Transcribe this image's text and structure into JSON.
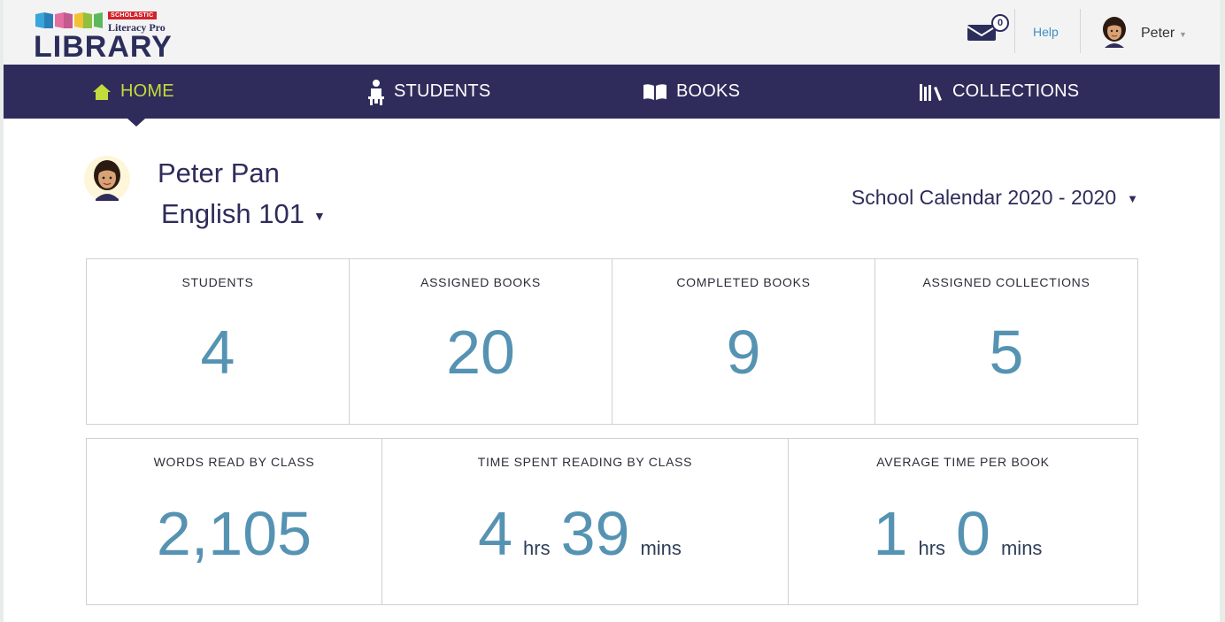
{
  "brand": {
    "badge": "SCHOLASTIC",
    "subtitle": "Literacy Pro",
    "title": "LIBRARY"
  },
  "header": {
    "mail_count": "0",
    "help_label": "Help",
    "user_name": "Peter"
  },
  "nav": {
    "items": [
      {
        "label": "HOME",
        "icon": "home-icon",
        "active": true
      },
      {
        "label": "STUDENTS",
        "icon": "student-icon",
        "active": false
      },
      {
        "label": "BOOKS",
        "icon": "book-icon",
        "active": false
      },
      {
        "label": "COLLECTIONS",
        "icon": "collections-icon",
        "active": false
      }
    ]
  },
  "profile": {
    "name": "Peter Pan",
    "class_name": "English 101",
    "calendar": "School Calendar 2020 - 2020"
  },
  "stats": {
    "students": {
      "label": "STUDENTS",
      "value": "4"
    },
    "assigned_books": {
      "label": "ASSIGNED BOOKS",
      "value": "20"
    },
    "completed_books": {
      "label": "COMPLETED BOOKS",
      "value": "9"
    },
    "assigned_collections": {
      "label": "ASSIGNED COLLECTIONS",
      "value": "5"
    },
    "words_read": {
      "label": "WORDS READ BY CLASS",
      "value": "2,105"
    },
    "time_spent": {
      "label": "TIME SPENT READING BY CLASS",
      "hours": "4",
      "hours_unit": "hrs",
      "minutes": "39",
      "minutes_unit": "mins"
    },
    "avg_time": {
      "label": "AVERAGE TIME PER BOOK",
      "hours": "1",
      "hours_unit": "hrs",
      "minutes": "0",
      "minutes_unit": "mins"
    }
  },
  "colors": {
    "nav_background": "#2f2c5b",
    "nav_active": "#c4db3c",
    "stat_value": "#5693b3",
    "link": "#3f8fc0"
  }
}
